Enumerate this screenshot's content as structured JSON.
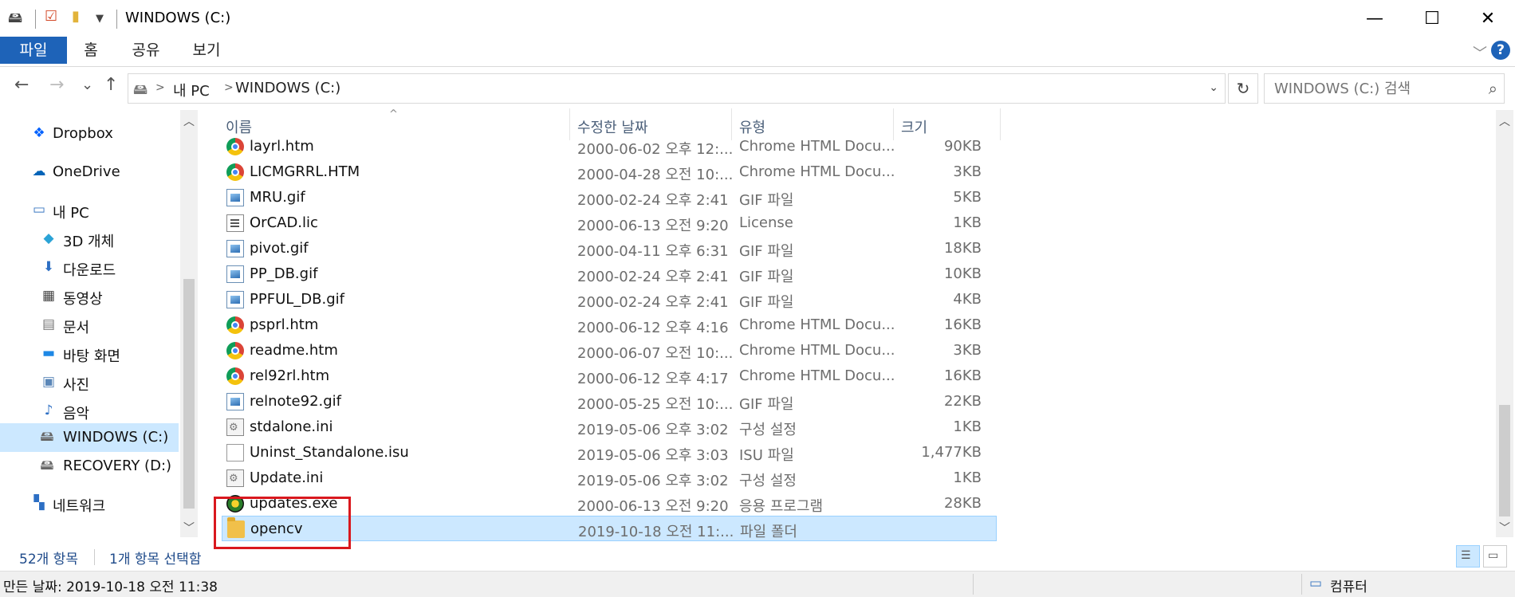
{
  "window": {
    "title": "WINDOWS (C:)",
    "minimize_icon": "—",
    "maximize_icon": "☐",
    "close_icon": "✕"
  },
  "ribbon": {
    "tabs": [
      {
        "label": "파일"
      },
      {
        "label": "홈"
      },
      {
        "label": "공유"
      },
      {
        "label": "보기"
      }
    ]
  },
  "navigation": {
    "back_icon": "←",
    "forward_icon": "→",
    "recent_icon": "⌄",
    "up_icon": "↑",
    "breadcrumb": [
      "내 PC",
      "WINDOWS (C:)"
    ],
    "breadcrumb_separator": ">",
    "refresh_icon": "↻",
    "search_placeholder": "WINDOWS (C:) 검색"
  },
  "sidebar": {
    "items": [
      {
        "label": "Dropbox",
        "icon": "dropbox-icon"
      },
      {
        "label": "OneDrive",
        "icon": "onedrive-icon"
      },
      {
        "label": "내 PC",
        "icon": "pc-icon"
      },
      {
        "label": "3D 개체",
        "icon": "3d-objects-icon"
      },
      {
        "label": "다운로드",
        "icon": "downloads-icon"
      },
      {
        "label": "동영상",
        "icon": "videos-icon"
      },
      {
        "label": "문서",
        "icon": "documents-icon"
      },
      {
        "label": "바탕 화면",
        "icon": "desktop-icon"
      },
      {
        "label": "사진",
        "icon": "pictures-icon"
      },
      {
        "label": "음악",
        "icon": "music-icon"
      },
      {
        "label": "WINDOWS (C:)",
        "icon": "drive-icon",
        "selected": true
      },
      {
        "label": "RECOVERY (D:)",
        "icon": "drive-icon"
      },
      {
        "label": "네트워크",
        "icon": "network-icon"
      }
    ]
  },
  "columns": {
    "name": "이름",
    "date": "수정한 날짜",
    "type": "유형",
    "size": "크기"
  },
  "files": [
    {
      "name": "layrl.htm",
      "date": "2000-06-02 오후 12:...",
      "type": "Chrome HTML Docu...",
      "size": "90KB",
      "icon": "chrome"
    },
    {
      "name": "LICMGRRL.HTM",
      "date": "2000-04-28 오전 10:...",
      "type": "Chrome HTML Docu...",
      "size": "3KB",
      "icon": "chrome"
    },
    {
      "name": "MRU.gif",
      "date": "2000-02-24 오후 2:41",
      "type": "GIF 파일",
      "size": "5KB",
      "icon": "gif"
    },
    {
      "name": "OrCAD.lic",
      "date": "2000-06-13 오전 9:20",
      "type": "License",
      "size": "1KB",
      "icon": "doc"
    },
    {
      "name": "pivot.gif",
      "date": "2000-04-11 오후 6:31",
      "type": "GIF 파일",
      "size": "18KB",
      "icon": "gif"
    },
    {
      "name": "PP_DB.gif",
      "date": "2000-02-24 오후 2:41",
      "type": "GIF 파일",
      "size": "10KB",
      "icon": "gif"
    },
    {
      "name": "PPFUL_DB.gif",
      "date": "2000-02-24 오후 2:41",
      "type": "GIF 파일",
      "size": "4KB",
      "icon": "gif"
    },
    {
      "name": "psprl.htm",
      "date": "2000-06-12 오후 4:16",
      "type": "Chrome HTML Docu...",
      "size": "16KB",
      "icon": "chrome"
    },
    {
      "name": "readme.htm",
      "date": "2000-06-07 오전 10:...",
      "type": "Chrome HTML Docu...",
      "size": "3KB",
      "icon": "chrome"
    },
    {
      "name": "rel92rl.htm",
      "date": "2000-06-12 오후 4:17",
      "type": "Chrome HTML Docu...",
      "size": "16KB",
      "icon": "chrome"
    },
    {
      "name": "relnote92.gif",
      "date": "2000-05-25 오전 10:...",
      "type": "GIF 파일",
      "size": "22KB",
      "icon": "gif"
    },
    {
      "name": "stdalone.ini",
      "date": "2019-05-06 오후 3:02",
      "type": "구성 설정",
      "size": "1KB",
      "icon": "ini"
    },
    {
      "name": "Uninst_Standalone.isu",
      "date": "2019-05-06 오후 3:03",
      "type": "ISU 파일",
      "size": "1,477KB",
      "icon": "blank"
    },
    {
      "name": "Update.ini",
      "date": "2019-05-06 오후 3:02",
      "type": "구성 설정",
      "size": "1KB",
      "icon": "ini"
    },
    {
      "name": "updates.exe",
      "date": "2000-06-13 오전 9:20",
      "type": "응용 프로그램",
      "size": "28KB",
      "icon": "exe"
    },
    {
      "name": "opencv",
      "date": "2019-10-18 오전 11:...",
      "type": "파일 폴더",
      "size": "",
      "icon": "folder",
      "selected": true
    }
  ],
  "status": {
    "item_count": "52개 항목",
    "selection": "1개 항목 선택함",
    "created": "만든 날짜: 2019-10-18 오전 11:38",
    "location": "컴퓨터"
  },
  "colors": {
    "accent": "#1e63b8",
    "selection_bg": "#cce8ff",
    "highlight_box": "#d9181e"
  }
}
